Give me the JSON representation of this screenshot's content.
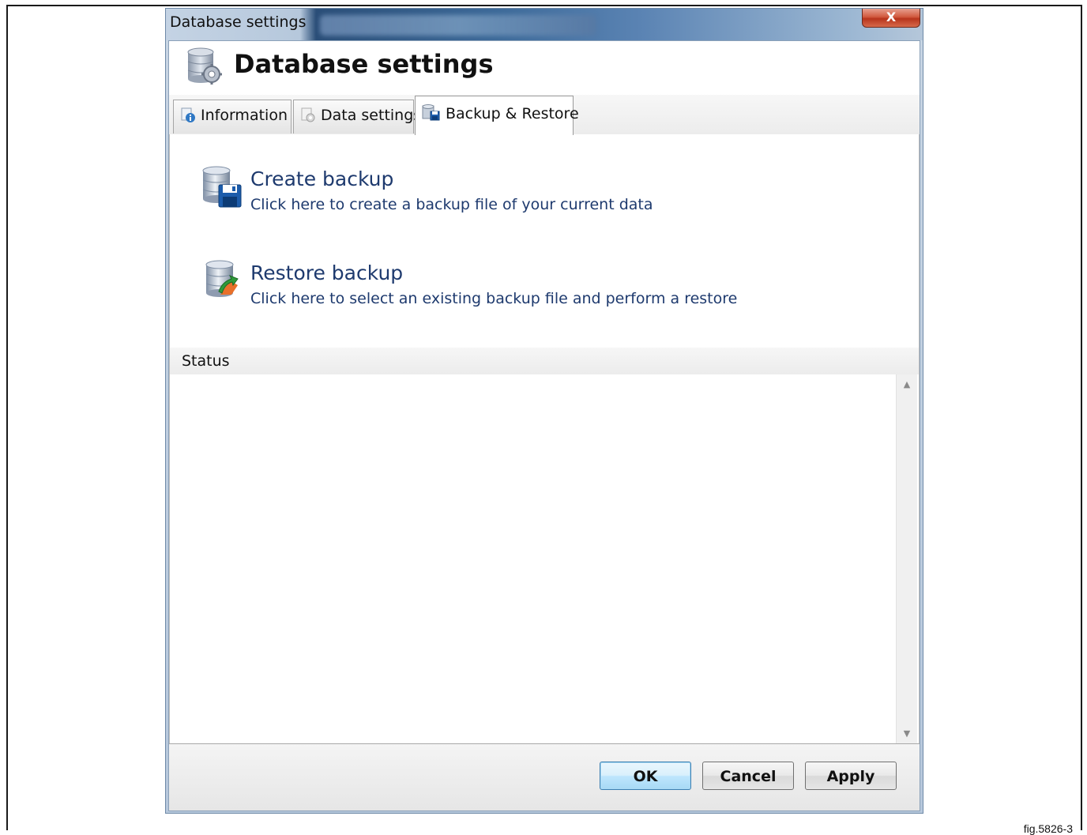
{
  "window": {
    "title": "Database settings",
    "close_label": "X"
  },
  "header": {
    "title": "Database settings",
    "icon": "database-gear-icon"
  },
  "tabs": [
    {
      "label": "Information",
      "icon": "info-icon",
      "active": false
    },
    {
      "label": "Data settings",
      "icon": "settings-doc-icon",
      "active": false
    },
    {
      "label": "Backup & Restore",
      "icon": "backup-restore-icon",
      "active": true
    }
  ],
  "actions": {
    "create": {
      "title": "Create backup",
      "description": "Click here to create a backup file of your current data",
      "icon": "database-save-icon"
    },
    "restore": {
      "title": "Restore backup",
      "description": "Click here to select an existing backup file and perform a restore",
      "icon": "database-restore-icon"
    }
  },
  "status": {
    "label": "Status",
    "content": ""
  },
  "buttons": {
    "ok": "OK",
    "cancel": "Cancel",
    "apply": "Apply"
  },
  "figure_caption": "fig.5826-3",
  "colors": {
    "link_text": "#1e3a6e",
    "default_button": "#bee6fd",
    "close_button": "#c8452a"
  }
}
